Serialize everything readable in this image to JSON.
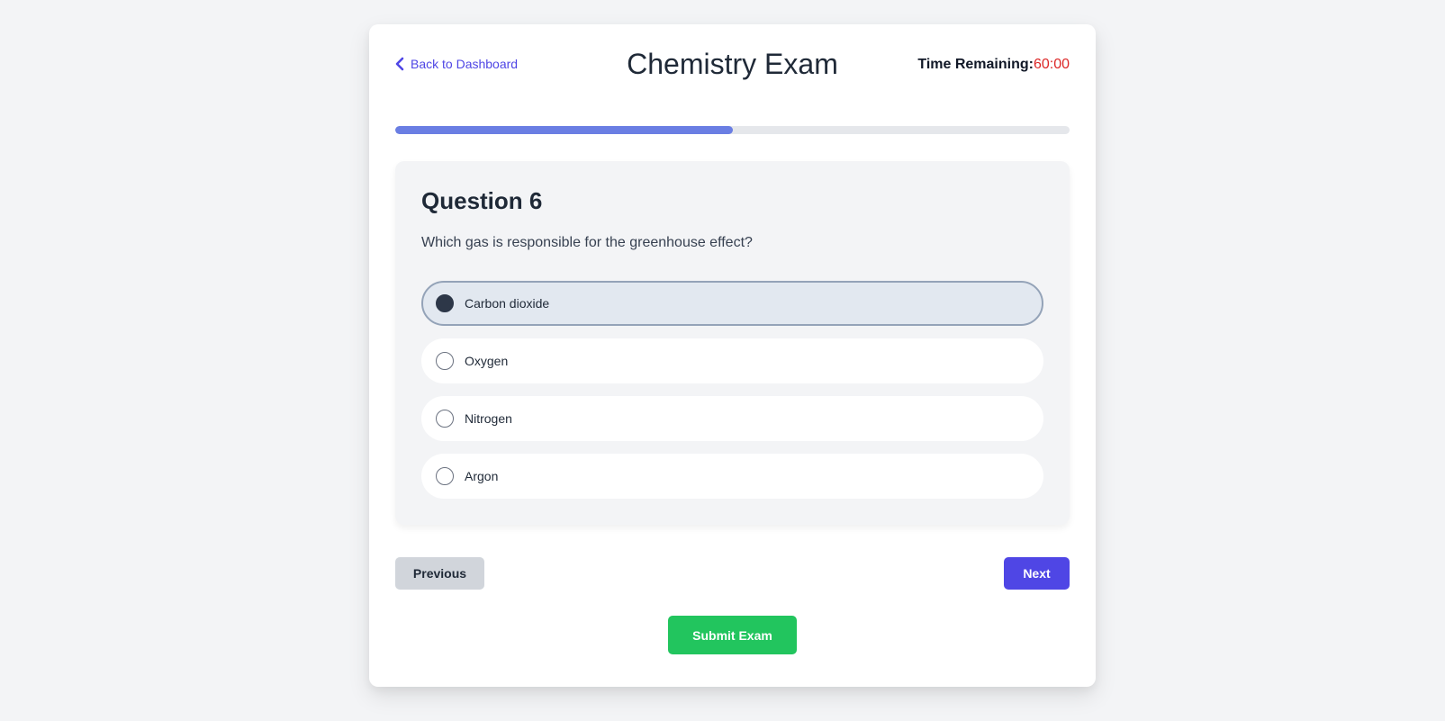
{
  "header": {
    "back_label": "Back to Dashboard",
    "title": "Chemistry Exam",
    "timer_label": "Time Remaining:",
    "timer_value": "60:00"
  },
  "progress": {
    "fraction": 0.5
  },
  "question": {
    "title": "Question 6",
    "text": "Which gas is responsible for the greenhouse effect?",
    "options": [
      {
        "label": "Carbon dioxide",
        "selected": true
      },
      {
        "label": "Oxygen",
        "selected": false
      },
      {
        "label": "Nitrogen",
        "selected": false
      },
      {
        "label": "Argon",
        "selected": false
      }
    ]
  },
  "navigation": {
    "previous_label": "Previous",
    "next_label": "Next",
    "submit_label": "Submit Exam"
  },
  "colors": {
    "accent": "#4f46e5",
    "progress_fill": "#6a7ee3",
    "timer": "#dc2626",
    "submit": "#22c55e",
    "selected_option_bg": "#e2e8f0"
  },
  "icons": {
    "back": "chevron-left-icon"
  }
}
